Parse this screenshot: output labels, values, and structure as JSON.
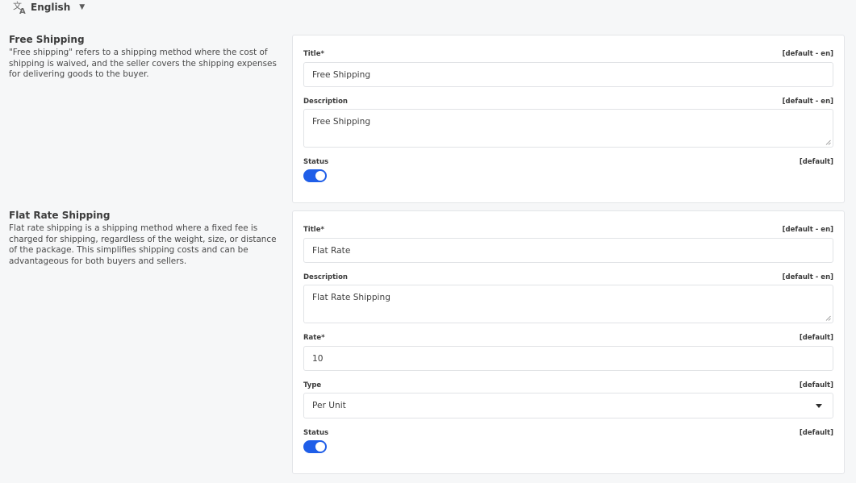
{
  "language": {
    "icon": "translate-icon",
    "label": "English"
  },
  "sections": {
    "free": {
      "title": "Free Shipping",
      "description": "\"Free shipping\" refers to a shipping method where the cost of shipping is waived, and the seller covers the shipping expenses for delivering goods to the buyer.",
      "title_label": "Title*",
      "title_scope": "[default - en]",
      "title_value": "Free Shipping",
      "desc_label": "Description",
      "desc_scope": "[default - en]",
      "desc_value": "Free Shipping",
      "status_label": "Status",
      "status_scope": "[default]",
      "status_on": true
    },
    "flat": {
      "title": "Flat Rate Shipping",
      "description": "Flat rate shipping is a shipping method where a fixed fee is charged for shipping, regardless of the weight, size, or distance of the package. This simplifies shipping costs and can be advantageous for both buyers and sellers.",
      "title_label": "Title*",
      "title_scope": "[default - en]",
      "title_value": "Flat Rate",
      "desc_label": "Description",
      "desc_scope": "[default - en]",
      "desc_value": "Flat Rate Shipping",
      "rate_label": "Rate*",
      "rate_scope": "[default]",
      "rate_value": "10",
      "type_label": "Type",
      "type_scope": "[default]",
      "type_value": "Per Unit",
      "status_label": "Status",
      "status_scope": "[default]",
      "status_on": true
    }
  },
  "colors": {
    "accent": "#1f5ee8",
    "card_border": "#e3e5e8",
    "background": "#f6f7f8"
  }
}
